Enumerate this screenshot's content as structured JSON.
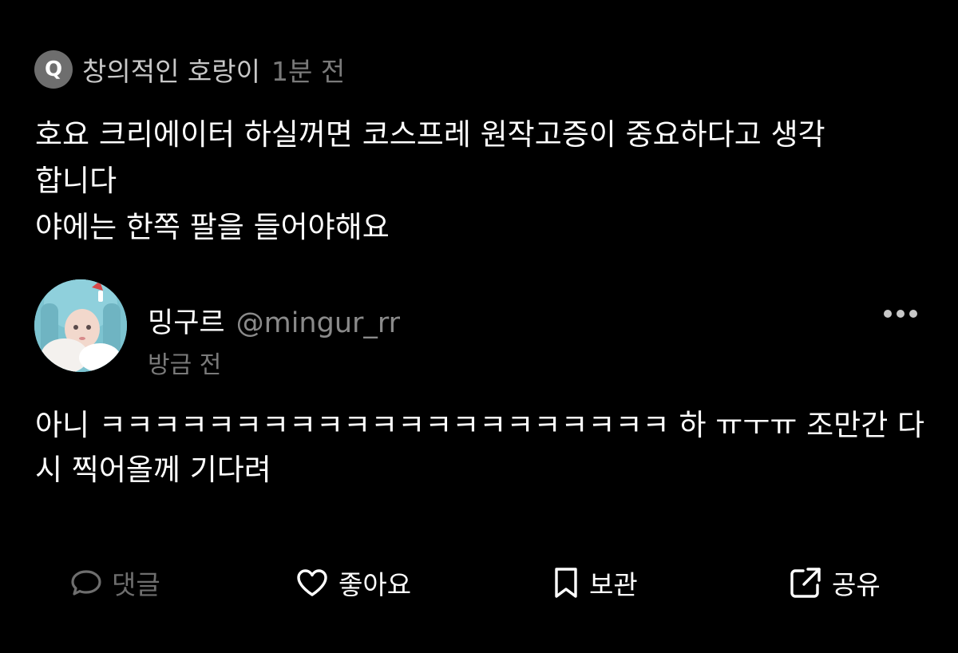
{
  "question": {
    "badge_letter": "Q",
    "asker_name": "창의적인 호랑이",
    "time": "1분 전",
    "lines": [
      "호요 크리에이터 하실꺼면 코스프레 원작고증이 중요하다고 생각",
      "합니다",
      "야에는 한쪽 팔을 들어야해요"
    ]
  },
  "answer": {
    "author_name": "밍구르",
    "author_handle": "@mingur_rr",
    "time": "방금 전",
    "more_icon": "more-horizontal-icon",
    "lines": [
      "아니 ㅋㅋㅋㅋㅋㅋㅋㅋㅋㅋㅋㅋㅋㅋㅋㅋㅋㅋㅋㅋㅋ 하 ㅠㅜㅠ 조만간 다",
      "시 찍어올께 기다려"
    ]
  },
  "actions": {
    "comment_label": "댓글",
    "like_label": "좋아요",
    "save_label": "보관",
    "share_label": "공유"
  },
  "colors": {
    "background": "#000000",
    "text_primary": "#ffffff",
    "text_secondary": "#7a7a7a",
    "disabled": "#6e6e6e"
  }
}
